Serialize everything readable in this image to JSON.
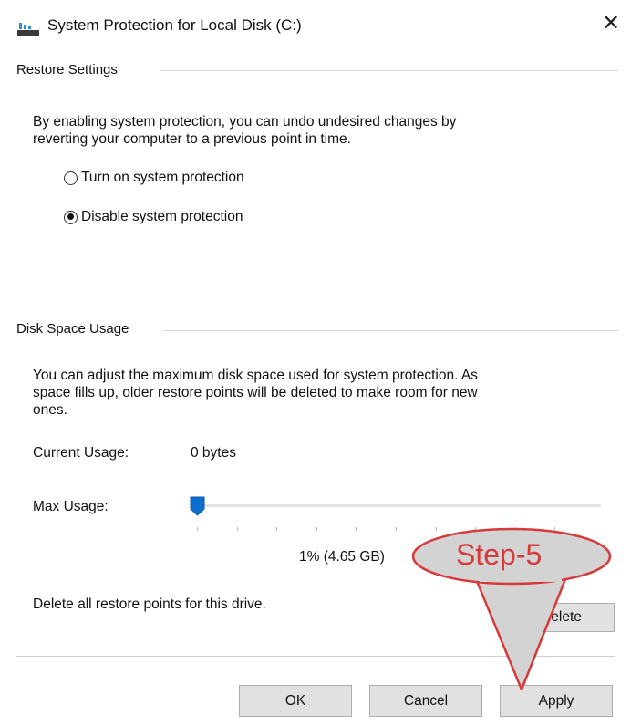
{
  "window": {
    "title": "System Protection for Local Disk (C:)",
    "close_glyph": "✕",
    "icon": "drive-icon"
  },
  "restore_settings": {
    "heading": "Restore Settings",
    "description_line1": "By enabling system protection, you can undo undesired changes by",
    "description_line2": "reverting your computer to a previous point in time.",
    "options": [
      {
        "label": "Turn on system protection",
        "checked": false
      },
      {
        "label": "Disable system protection",
        "checked": true
      }
    ]
  },
  "disk_space": {
    "heading": "Disk Space Usage",
    "description_line1": "You can adjust the maximum disk space used for system protection. As",
    "description_line2": "space fills up, older restore points will be deleted to make room for new",
    "description_line3": "ones.",
    "current_usage_label": "Current Usage:",
    "current_usage_value": "0 bytes",
    "max_usage_label": "Max Usage:",
    "max_usage_value": "1% (4.65 GB)",
    "max_usage_percent": 1,
    "delete_text": "Delete all restore points for this drive.",
    "delete_button": "Delete"
  },
  "buttons": {
    "ok": "OK",
    "cancel": "Cancel",
    "apply": "Apply"
  },
  "annotation": {
    "callout_text": "Step-5",
    "color": "#d63a3a"
  }
}
